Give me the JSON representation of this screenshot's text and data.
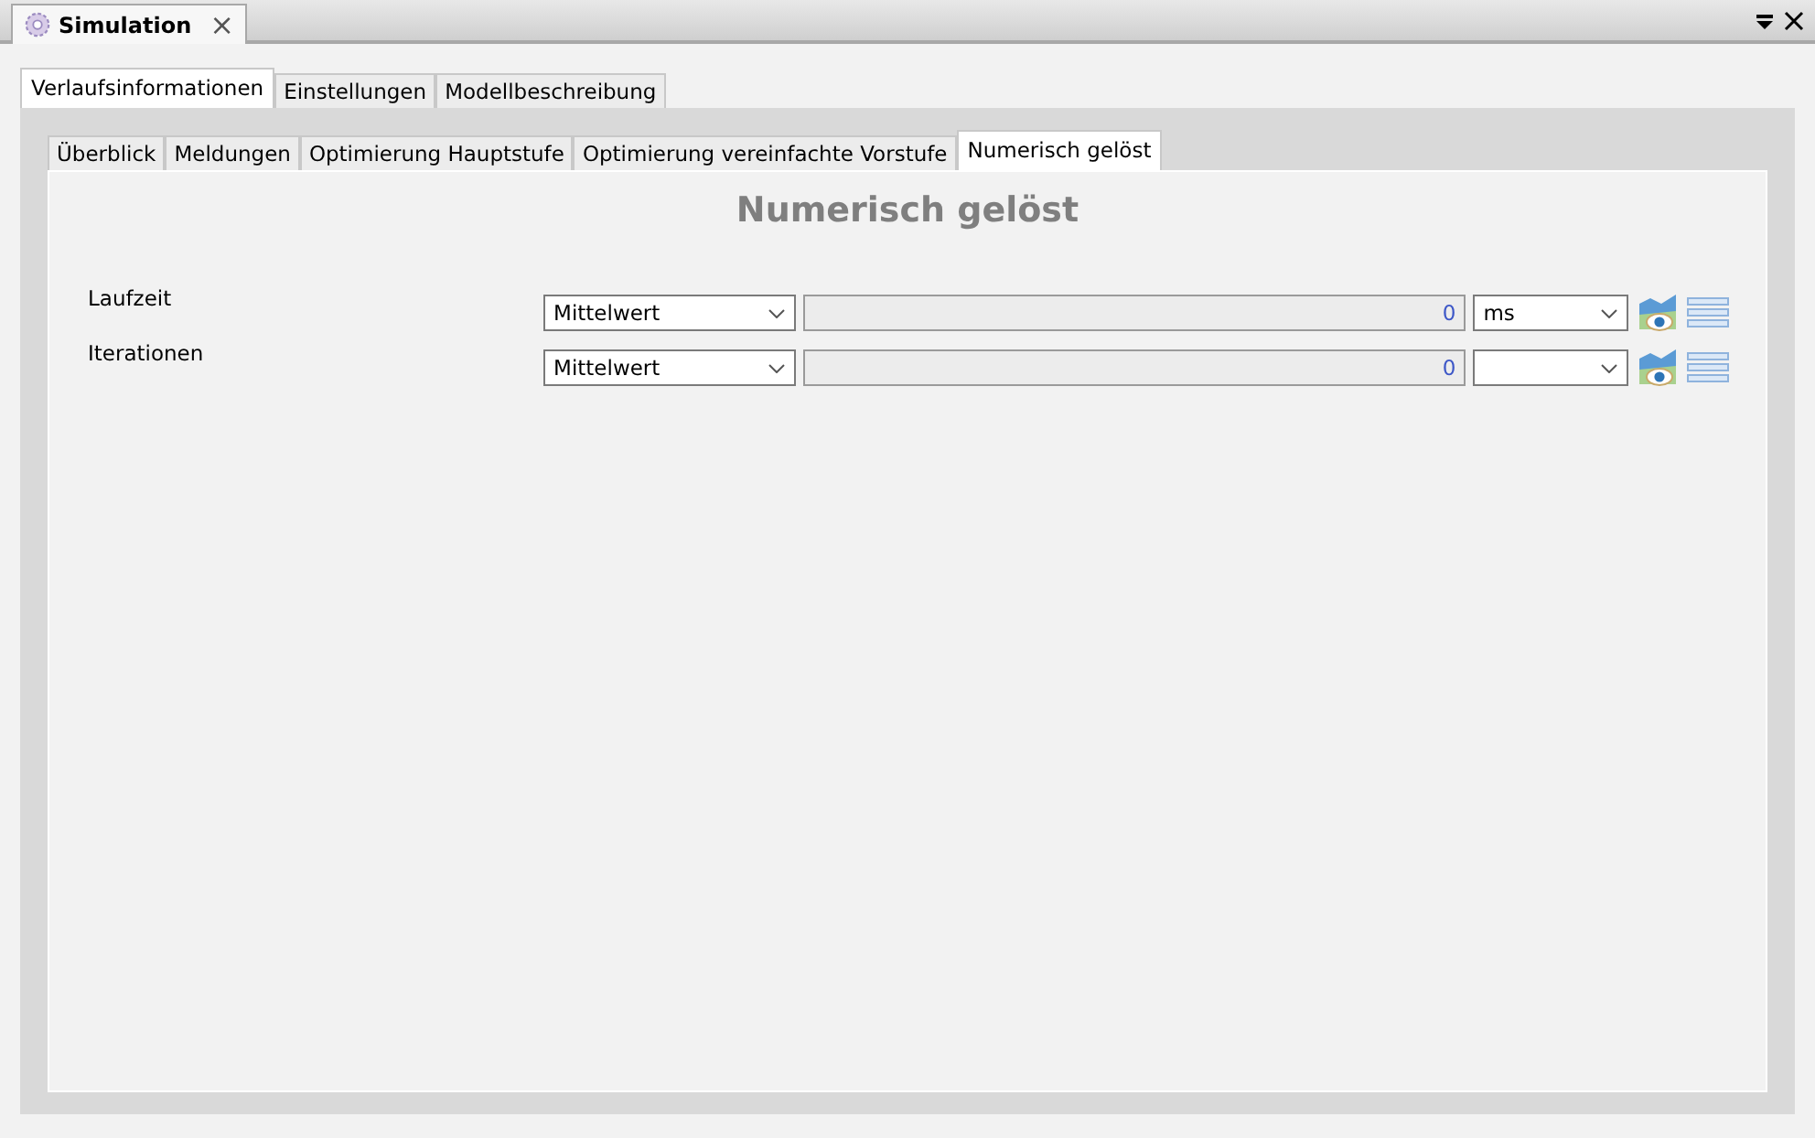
{
  "view_tab": {
    "title": "Simulation",
    "close": "×"
  },
  "outer_tabs": [
    {
      "label": "Verlaufsinformationen",
      "selected": true
    },
    {
      "label": "Einstellungen",
      "selected": false
    },
    {
      "label": "Modellbeschreibung",
      "selected": false
    }
  ],
  "inner_tabs": [
    {
      "label": "Überblick",
      "selected": false
    },
    {
      "label": "Meldungen",
      "selected": false
    },
    {
      "label": "Optimierung Hauptstufe",
      "selected": false
    },
    {
      "label": "Optimierung vereinfachte Vorstufe",
      "selected": false
    },
    {
      "label": "Numerisch gelöst",
      "selected": true
    }
  ],
  "heading": "Numerisch gelöst",
  "rows": [
    {
      "label": "Laufzeit",
      "mode": "Mittelwert",
      "value": "0",
      "unit": "ms"
    },
    {
      "label": "Iterationen",
      "mode": "Mittelwert",
      "value": "0"
    }
  ]
}
